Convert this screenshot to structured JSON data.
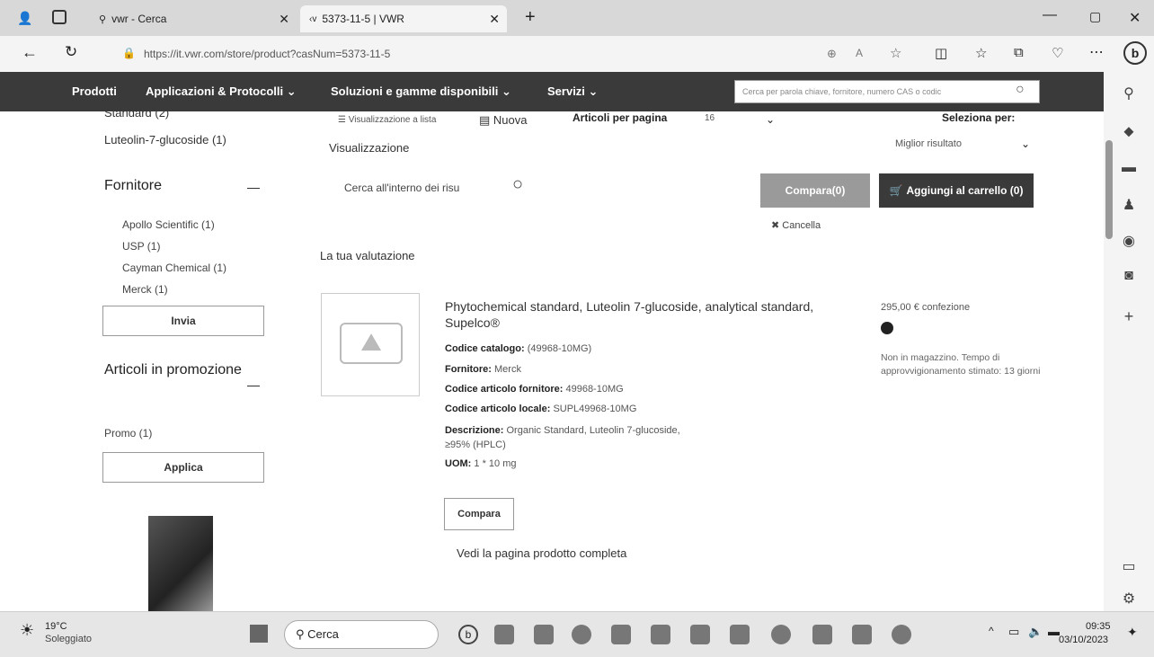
{
  "tabs": [
    {
      "label": "vwr - Cerca",
      "icon": "search-icon"
    },
    {
      "label": "5373-11-5 | VWR",
      "icon": "vwr-logo-icon"
    }
  ],
  "address": {
    "url": "https://it.vwr.com/store/product?casNum=5373-11-5"
  },
  "nav": {
    "items": [
      "Prodotti",
      "Applicazioni & Protocolli",
      "Soluzioni e gamme disponibili",
      "Servizi"
    ],
    "search_placeholder": "Cerca per parola chiave, fornitore, numero CAS o codic"
  },
  "sidebar": {
    "standard_item": "Standard (2)",
    "luteolin_item": "Luteolin-7-glucoside (1)",
    "supplier_title": "Fornitore",
    "suppliers": [
      "Apollo Scientific (1)",
      "USP (1)",
      "Cayman Chemical (1)",
      "Merck (1)"
    ],
    "submit_label": "Invia",
    "promo_title": "Articoli in promozione",
    "promo_item": "Promo (1)",
    "apply_label": "Applica"
  },
  "toolbar": {
    "list_view": "Visualizzazione a lista",
    "new_label": "Nuova",
    "view_label": "Visualizzazione",
    "per_page_label": "Articoli per pagina",
    "per_page_value": "16",
    "sort_label": "Seleziona per:",
    "sort_value": "Miglior risultato",
    "search_within": "Cerca all'interno dei risu",
    "compare_btn": "Compara(0)",
    "cart_btn": "Aggiungi al carrello (0)",
    "cancel_label": "Cancella",
    "rating_label": "La tua valutazione"
  },
  "product": {
    "title": "Phytochemical standard, Luteolin 7-glucoside, analytical standard, Supelco®",
    "catalog_label": "Codice catalogo:",
    "catalog_value": "(49968-10MG)",
    "supplier_label": "Fornitore:",
    "supplier_value": "Merck",
    "supplier_code_label": "Codice articolo fornitore:",
    "supplier_code_value": "49968-10MG",
    "local_code_label": "Codice articolo locale:",
    "local_code_value": "SUPL49968-10MG",
    "description_label": "Descrizione:",
    "description_value": "Organic Standard, Luteolin 7-glucoside, ≥95% (HPLC)",
    "uom_label": "UOM:",
    "uom_value": "1 * 10 mg",
    "price": "295,00 €",
    "price_unit": "confezione",
    "availability": "Non in magazzino. Tempo di approvvigionamento stimato: 13 giorni",
    "compare_label": "Compara",
    "full_page_link": "Vedi la pagina prodotto completa"
  },
  "taskbar": {
    "weather_temp": "19°C",
    "weather_desc": "Soleggiato",
    "search_label": "Cerca",
    "time": "09:35",
    "date": "03/10/2023"
  }
}
